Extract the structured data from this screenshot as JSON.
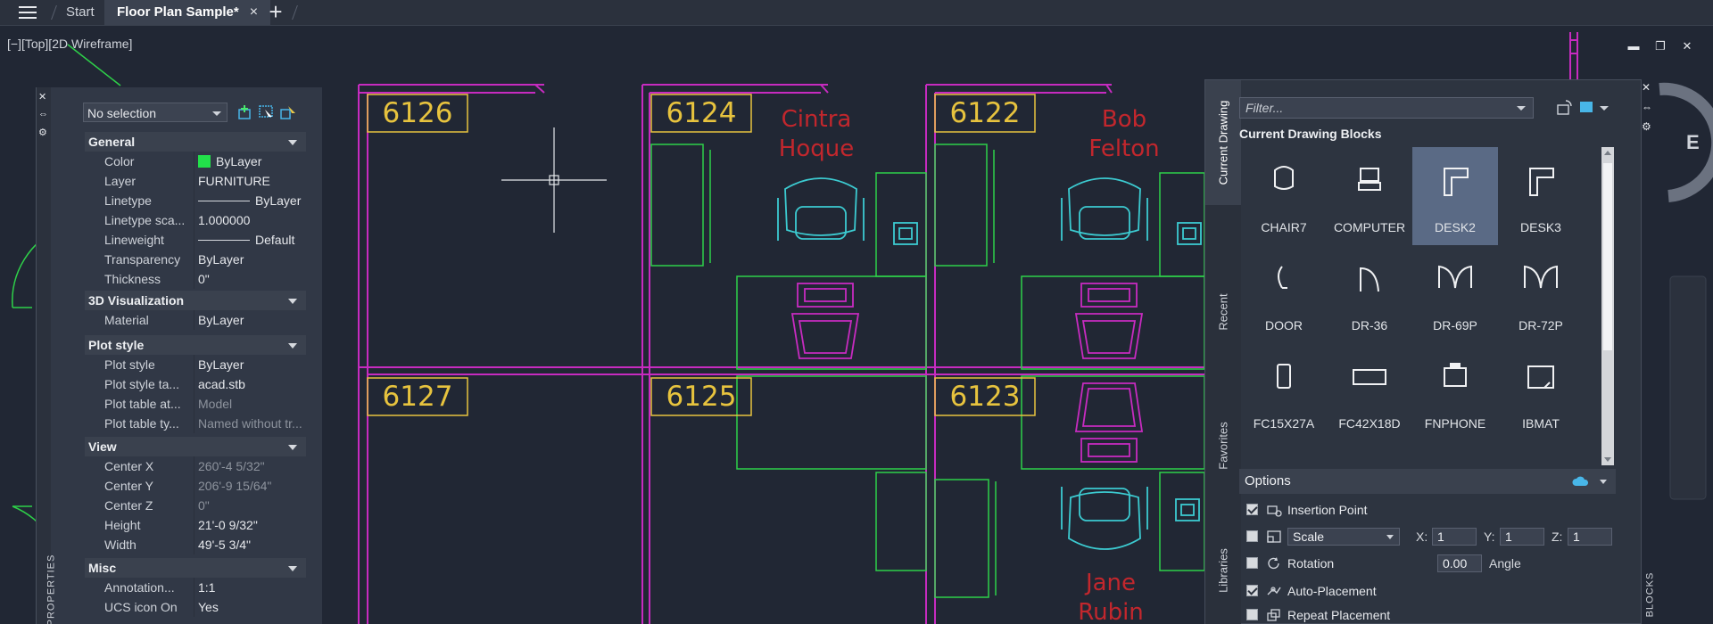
{
  "tabs": [
    {
      "label": "Start"
    },
    {
      "label": "Floor Plan Sample*",
      "close": "×"
    }
  ],
  "new_tab_label": "+",
  "viewport_label": "[−][Top][2D Wireframe]",
  "window_controls": [
    "▬",
    "❐",
    "✕"
  ],
  "rooms": [
    "6126",
    "6124",
    "6122",
    "6127",
    "6125",
    "6123"
  ],
  "occupants": [
    {
      "first": "Cintra",
      "last": "Hoque"
    },
    {
      "first": "Bob",
      "last": "Felton"
    },
    {
      "first": "Jane",
      "last": "Rubin"
    }
  ],
  "properties": {
    "palette_title": "PROPERTIES",
    "palette_controls": [
      "✕",
      "⇔",
      "⚙"
    ],
    "selection": "No selection",
    "sections": {
      "general": {
        "title": "General",
        "rows": [
          {
            "label": "Color",
            "value": "ByLayer"
          },
          {
            "label": "Layer",
            "value": "FURNITURE"
          },
          {
            "label": "Linetype",
            "value": "ByLayer"
          },
          {
            "label": "Linetype sca...",
            "value": "1.000000"
          },
          {
            "label": "Lineweight",
            "value": "Default"
          },
          {
            "label": "Transparency",
            "value": "ByLayer"
          },
          {
            "label": "Thickness",
            "value": "0\""
          }
        ]
      },
      "viz": {
        "title": "3D Visualization",
        "rows": [
          {
            "label": "Material",
            "value": "ByLayer"
          }
        ]
      },
      "plot": {
        "title": "Plot style",
        "rows": [
          {
            "label": "Plot style",
            "value": "ByLayer"
          },
          {
            "label": "Plot style ta...",
            "value": "acad.stb"
          },
          {
            "label": "Plot table at...",
            "value": "Model"
          },
          {
            "label": "Plot table ty...",
            "value": "Named without tr..."
          }
        ]
      },
      "view": {
        "title": "View",
        "rows": [
          {
            "label": "Center X",
            "value": "260'-4 5/32\""
          },
          {
            "label": "Center Y",
            "value": "206'-9 15/64\""
          },
          {
            "label": "Center Z",
            "value": "0\""
          },
          {
            "label": "Height",
            "value": "21'-0 9/32\""
          },
          {
            "label": "Width",
            "value": "49'-5 3/4\""
          }
        ]
      },
      "misc": {
        "title": "Misc",
        "rows": [
          {
            "label": "Annotation...",
            "value": "1:1"
          },
          {
            "label": "UCS icon On",
            "value": "Yes"
          }
        ]
      }
    }
  },
  "blocks": {
    "side_tabs": [
      "Current Drawing",
      "Recent",
      "Favorites",
      "Libraries"
    ],
    "filter_placeholder": "Filter...",
    "section_title": "Current Drawing Blocks",
    "palette_controls": [
      "✕",
      "⇔",
      "⚙"
    ],
    "items": [
      {
        "name": "CHAIR7",
        "icon": "chair-icon"
      },
      {
        "name": "COMPUTER",
        "icon": "computer-icon"
      },
      {
        "name": "DESK2",
        "icon": "desk-icon",
        "selected": true
      },
      {
        "name": "DESK3",
        "icon": "desk-icon"
      },
      {
        "name": "DOOR",
        "icon": "door-icon"
      },
      {
        "name": "DR-36",
        "icon": "door-swing-icon"
      },
      {
        "name": "DR-69P",
        "icon": "double-door-icon"
      },
      {
        "name": "DR-72P",
        "icon": "double-door-icon"
      },
      {
        "name": "FC15X27A",
        "icon": "file-cabinet-icon"
      },
      {
        "name": "FC42X18D",
        "icon": "file-cabinet-icon"
      },
      {
        "name": "FNPHONE",
        "icon": "phone-icon"
      },
      {
        "name": "IBMAT",
        "icon": "mat-icon"
      }
    ],
    "options": {
      "title": "Options",
      "insertion_point": {
        "label": "Insertion Point",
        "checked": true
      },
      "scale": {
        "label": "Scale",
        "checked": false,
        "x_label": "X:",
        "x": "1",
        "y_label": "Y:",
        "y": "1",
        "z_label": "Z:",
        "z": "1"
      },
      "rotation": {
        "label": "Rotation",
        "checked": false,
        "value": "0.00",
        "unit": "Angle"
      },
      "auto_placement": {
        "label": "Auto-Placement",
        "checked": true
      },
      "repeat_placement": {
        "label": "Repeat Placement",
        "checked": false
      }
    }
  },
  "right_edge": {
    "compass_letter": "E",
    "vertical_label": "BLOCKS"
  },
  "colors": {
    "walls": "#c72bc0",
    "furniture": "#2ed149",
    "fixtures": "#3ccbd1",
    "room_tags": "#e7c33e",
    "names": "#c2272d"
  }
}
